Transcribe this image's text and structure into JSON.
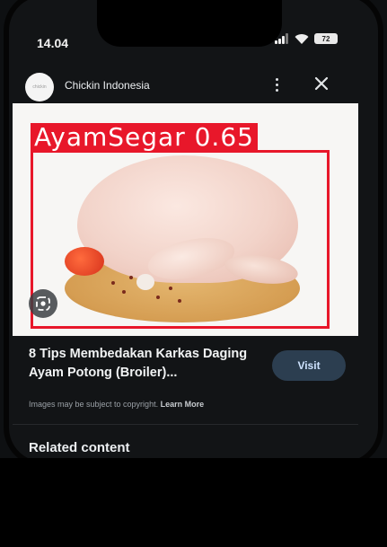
{
  "status_bar": {
    "time": "14.04",
    "battery": "72"
  },
  "header": {
    "source_name": "Chickin Indonesia",
    "avatar_text": "chickin"
  },
  "image": {
    "detection_label": "AyamSegar 0.65"
  },
  "result": {
    "title": "8 Tips Membedakan Karkas Daging Ayam Potong (Broiler)...",
    "visit_label": "Visit",
    "copyright_text": "Images may be subject to copyright.",
    "learn_more": "Learn More"
  },
  "related_heading": "Related content",
  "colors": {
    "detection_red": "#e8172a",
    "background": "#0e1012",
    "visit_button": "#2c3e50"
  },
  "icons": [
    "signal-icon",
    "wifi-icon",
    "battery-icon",
    "more-vert-icon",
    "close-icon",
    "lens-icon"
  ]
}
